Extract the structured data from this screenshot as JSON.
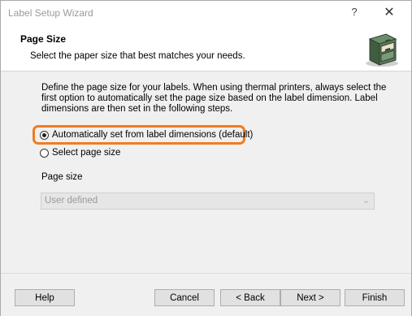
{
  "window": {
    "title": "Label Setup Wizard",
    "help_glyph": "?",
    "close_glyph": "✕"
  },
  "header": {
    "title": "Page Size",
    "subtitle": "Select the paper size that best matches your needs.",
    "icon": "file-cabinet-icon"
  },
  "content": {
    "description": "Define the page size for your labels. When using thermal printers, always select the first option to automatically set the page size based on the label dimension. Label dimensions are then set in the following steps.",
    "options": [
      {
        "label": "Automatically set from label dimensions (default)",
        "selected": true,
        "highlighted": true
      },
      {
        "label": "Select page size",
        "selected": false
      }
    ],
    "page_size_label": "Page size",
    "page_size_value": "User defined",
    "page_size_disabled": true
  },
  "footer": {
    "help": "Help",
    "cancel": "Cancel",
    "back": "< Back",
    "next": "Next >",
    "finish": "Finish"
  },
  "colors": {
    "highlight": "#f07c22",
    "window_bg": "#f0f0f0"
  }
}
